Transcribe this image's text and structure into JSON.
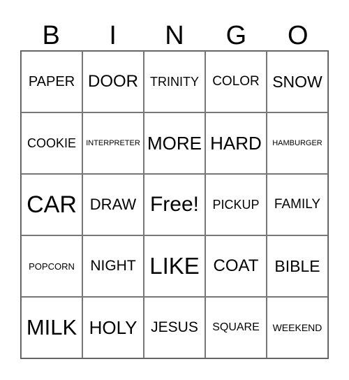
{
  "header": [
    "B",
    "I",
    "N",
    "G",
    "O"
  ],
  "cells": [
    {
      "text": "PAPER",
      "size": 20
    },
    {
      "text": "DOOR",
      "size": 24
    },
    {
      "text": "TRINITY",
      "size": 18
    },
    {
      "text": "COLOR",
      "size": 19
    },
    {
      "text": "SNOW",
      "size": 23
    },
    {
      "text": "COOKIE",
      "size": 18
    },
    {
      "text": "INTERPRETER",
      "size": 11
    },
    {
      "text": "MORE",
      "size": 26
    },
    {
      "text": "HARD",
      "size": 26
    },
    {
      "text": "HAMBURGER",
      "size": 11
    },
    {
      "text": "CAR",
      "size": 34
    },
    {
      "text": "DRAW",
      "size": 22
    },
    {
      "text": "Free!",
      "size": 30
    },
    {
      "text": "PICKUP",
      "size": 18
    },
    {
      "text": "FAMILY",
      "size": 19
    },
    {
      "text": "POPCORN",
      "size": 13
    },
    {
      "text": "NIGHT",
      "size": 21
    },
    {
      "text": "LIKE",
      "size": 33
    },
    {
      "text": "COAT",
      "size": 24
    },
    {
      "text": "BIBLE",
      "size": 23
    },
    {
      "text": "MILK",
      "size": 31
    },
    {
      "text": "HOLY",
      "size": 26
    },
    {
      "text": "JESUS",
      "size": 21
    },
    {
      "text": "SQUARE",
      "size": 16
    },
    {
      "text": "WEEKEND",
      "size": 14
    }
  ]
}
